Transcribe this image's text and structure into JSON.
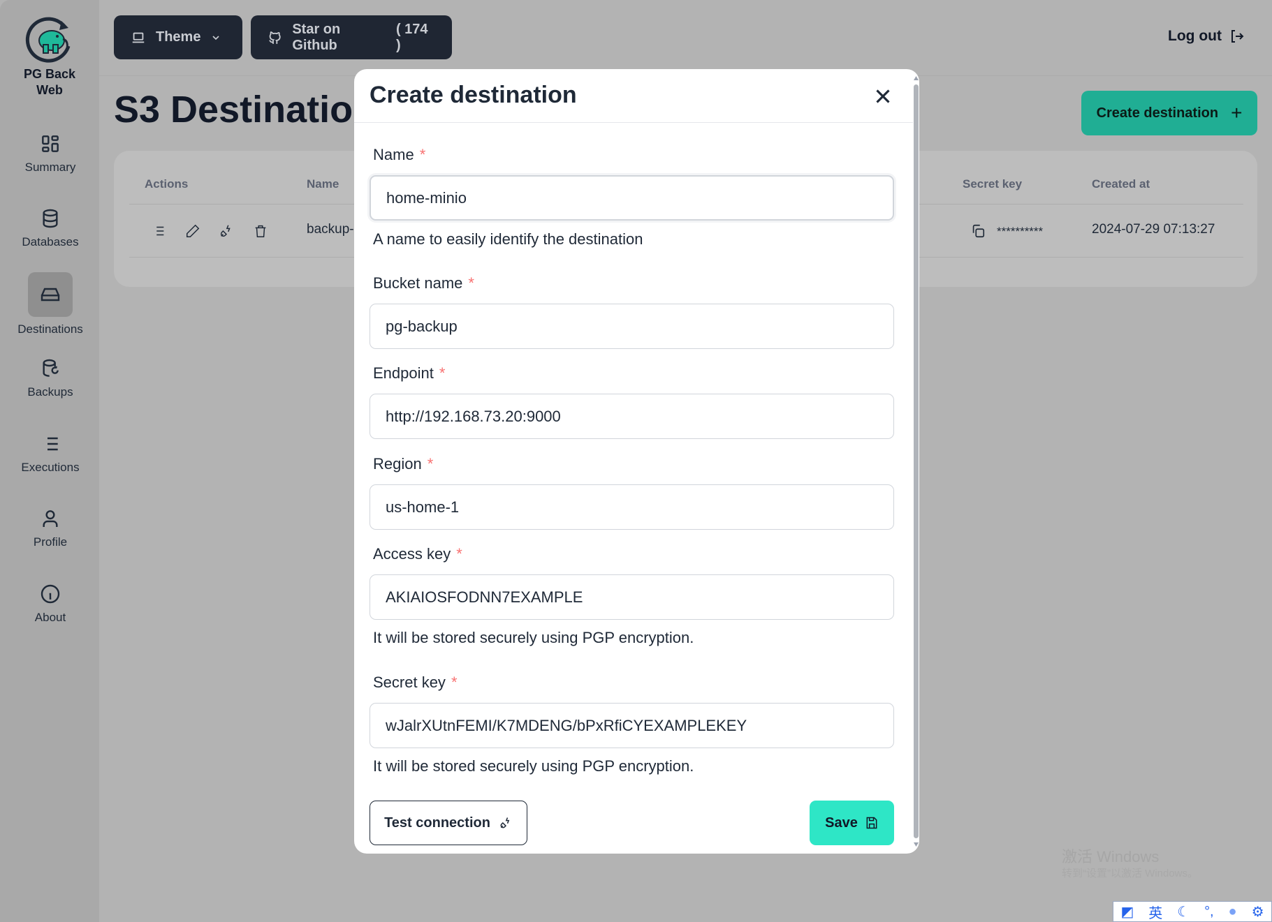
{
  "app": {
    "name_line1": "PG Back",
    "name_line2": "Web"
  },
  "sidebar": {
    "items": [
      {
        "label": "Summary",
        "icon": "grid-icon"
      },
      {
        "label": "Databases",
        "icon": "database-icon"
      },
      {
        "label": "Destinations",
        "icon": "hard-drive-icon",
        "active": true
      },
      {
        "label": "Backups",
        "icon": "database-restore-icon"
      },
      {
        "label": "Executions",
        "icon": "list-icon"
      },
      {
        "label": "Profile",
        "icon": "user-icon"
      },
      {
        "label": "About",
        "icon": "info-icon"
      }
    ]
  },
  "header": {
    "theme_label": "Theme",
    "github_label": "Star on Github",
    "github_count": "( 174 )",
    "logout_label": "Log out"
  },
  "page": {
    "title": "S3 Destinations",
    "create_label": "Create destination"
  },
  "table": {
    "columns": {
      "actions": "Actions",
      "name": "Name",
      "secret_key": "Secret key",
      "created_at": "Created at"
    },
    "rows": [
      {
        "name": "backup-",
        "access_key_partial": "**",
        "secret_key": "**********",
        "created_at": "2024-07-29 07:13:27"
      }
    ]
  },
  "modal": {
    "title": "Create destination",
    "fields": {
      "name": {
        "label": "Name",
        "value": "home-minio",
        "help": "A name to easily identify the destination"
      },
      "bucket": {
        "label": "Bucket name",
        "value": "pg-backup"
      },
      "endpoint": {
        "label": "Endpoint",
        "value": "http://192.168.73.20:9000"
      },
      "region": {
        "label": "Region",
        "value": "us-home-1"
      },
      "access": {
        "label": "Access key",
        "value": "AKIAIOSFODNN7EXAMPLE",
        "help": "It will be stored securely using PGP encryption."
      },
      "secret": {
        "label": "Secret key",
        "value": "wJalrXUtnFEMI/K7MDENG/bPxRfiCYEXAMPLEKEY",
        "help": "It will be stored securely using PGP encryption."
      }
    },
    "required_mark": "*",
    "test_label": "Test connection",
    "save_label": "Save"
  },
  "watermark": {
    "line1": "激活 Windows",
    "line2": "转到“设置”以激活 Windows。"
  },
  "ime": {
    "lang": "英"
  },
  "colors": {
    "accent": "#2ee6c6",
    "brand_dim": "#20ae94",
    "required": "#f87272",
    "dark_button": "#1f2633"
  }
}
